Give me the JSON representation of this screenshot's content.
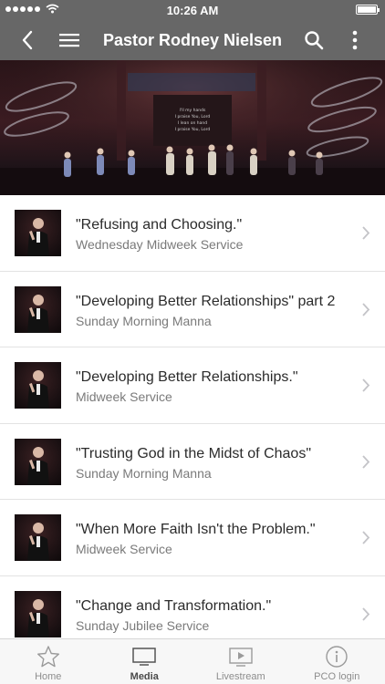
{
  "status_bar": {
    "time": "10:26 AM"
  },
  "nav": {
    "title": "Pastor Rodney Nielsen"
  },
  "hero": {
    "screen_lines": [
      "I'll my hands",
      "I praise You, Lord",
      "I lean on hand",
      "I praise You, Lord"
    ]
  },
  "list": {
    "items": [
      {
        "title": "\"Refusing and Choosing.\"",
        "subtitle": "Wednesday Midweek Service"
      },
      {
        "title": "\"Developing Better Relationships\" part 2",
        "subtitle": "Sunday Morning Manna"
      },
      {
        "title": "\"Developing Better Relationships.\"",
        "subtitle": "Midweek Service"
      },
      {
        "title": "\"Trusting God in the Midst of Chaos\"",
        "subtitle": "Sunday Morning Manna"
      },
      {
        "title": "\"When More Faith Isn't the Problem.\"",
        "subtitle": "Midweek Service"
      },
      {
        "title": "\"Change and Transformation.\"",
        "subtitle": "Sunday Jubilee Service"
      }
    ]
  },
  "tabs": [
    {
      "label": "Home",
      "icon": "star-icon"
    },
    {
      "label": "Media",
      "icon": "tv-icon",
      "active": true
    },
    {
      "label": "Livestream",
      "icon": "play-icon"
    },
    {
      "label": "PCO login",
      "icon": "info-icon"
    }
  ],
  "colors": {
    "nav": "#676767",
    "divider": "#e3e3e3",
    "tab_bar": "#f7f7f7"
  }
}
